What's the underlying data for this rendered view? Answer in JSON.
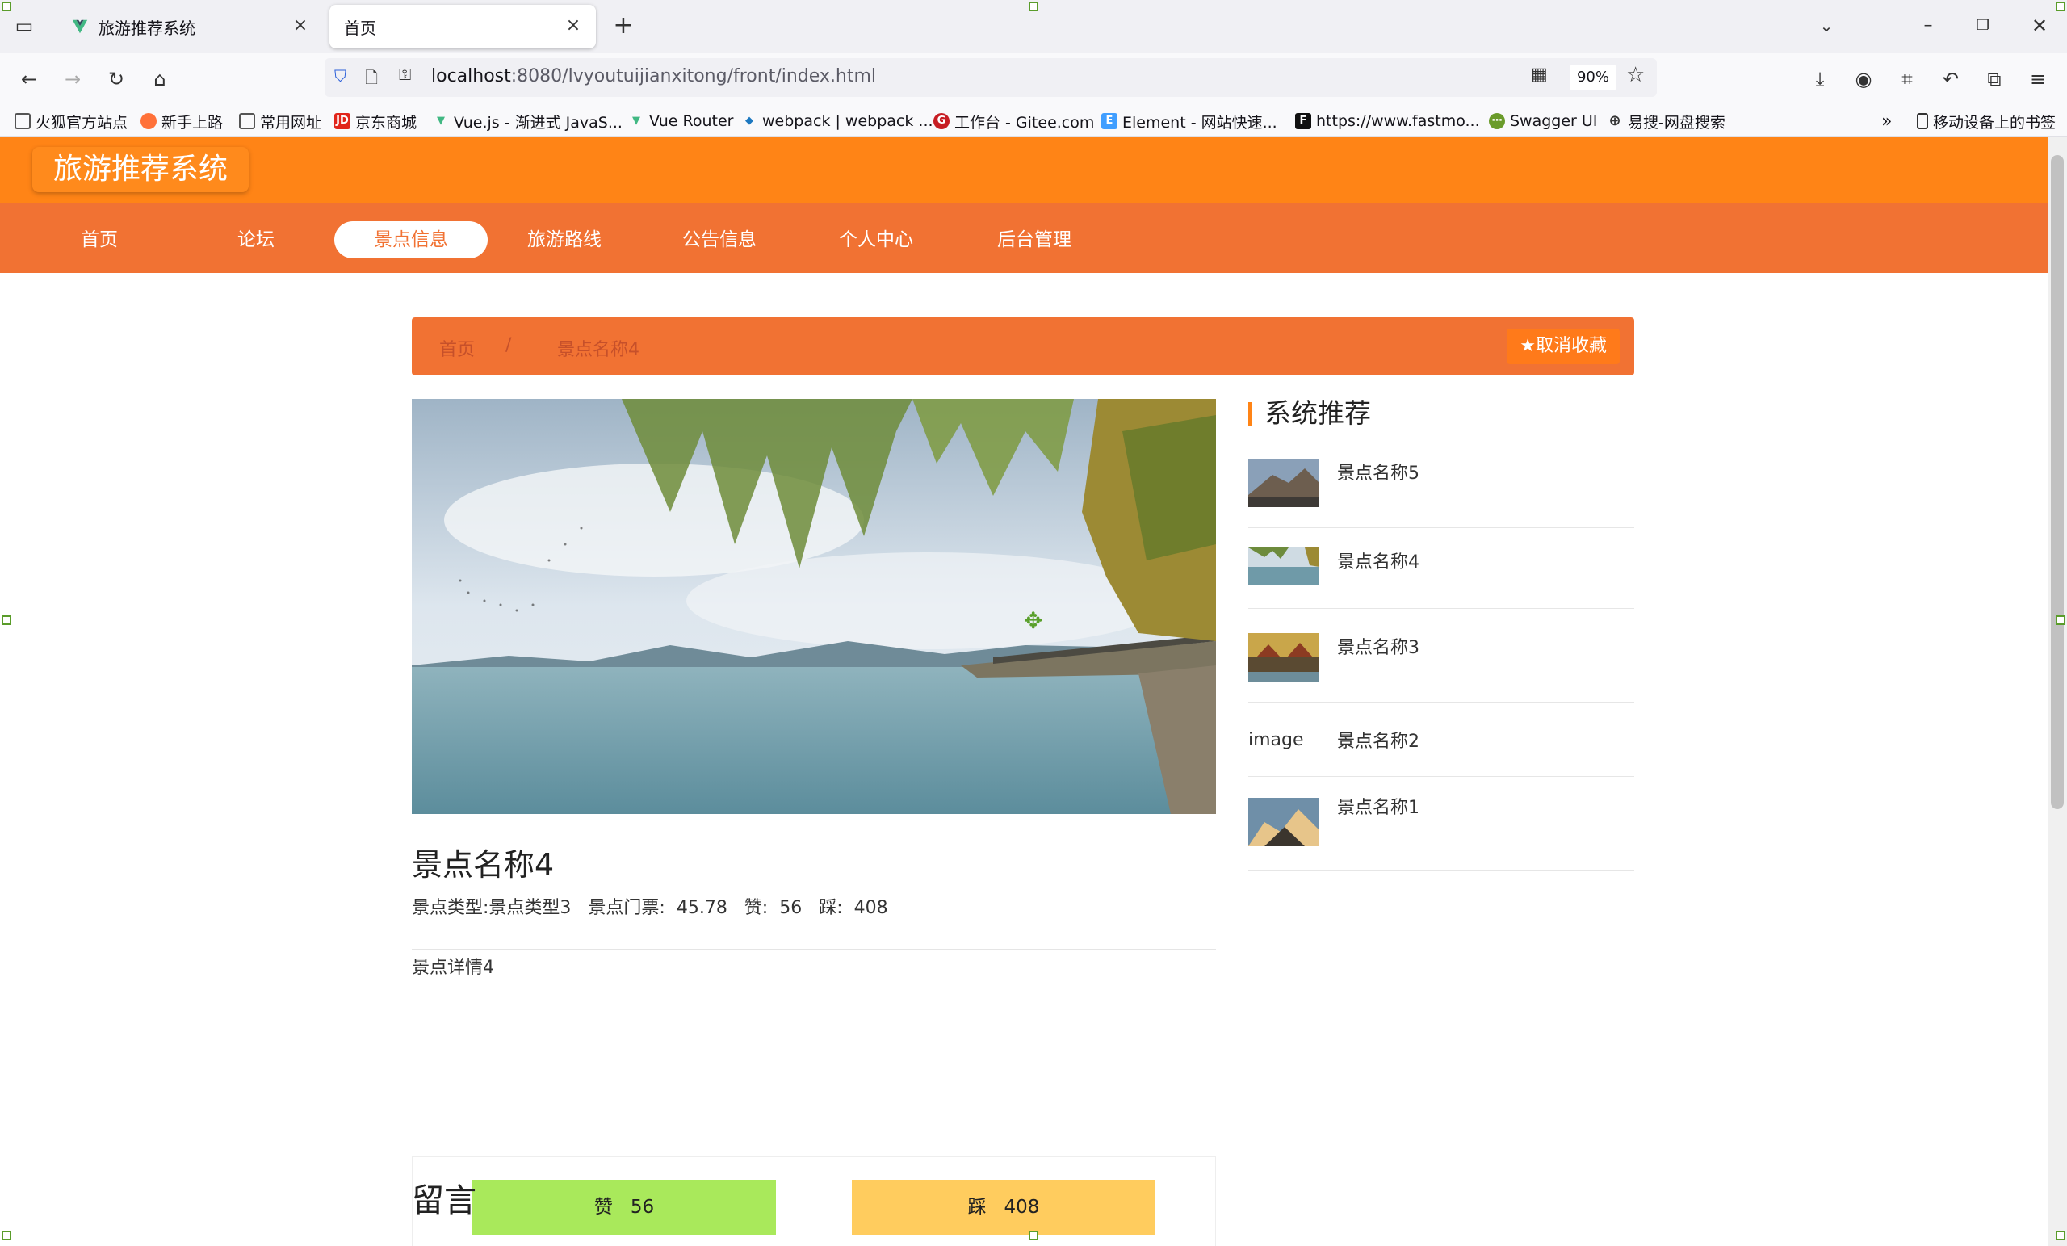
{
  "browser": {
    "tabs": [
      {
        "title": "旅游推荐系统",
        "active": false
      },
      {
        "title": "首页",
        "active": true
      }
    ],
    "url_host": "localhost",
    "url_rest": ":8080/lvyoutuijianxitong/front/index.html",
    "zoom": "90%",
    "bookmarks": [
      "火狐官方站点",
      "新手上路",
      "常用网址",
      "京东商城",
      "Vue.js - 渐进式 JavaS...",
      "Vue Router",
      "webpack | webpack ...",
      "工作台 - Gitee.com",
      "Element - 网站快速...",
      "https://www.fastmo...",
      "Swagger UI",
      "易搜-网盘搜索"
    ],
    "mobile_bookmarks": "移动设备上的书签"
  },
  "site": {
    "title": "旅游推荐系统",
    "nav": [
      {
        "label": "首页",
        "active": false
      },
      {
        "label": "论坛",
        "active": false
      },
      {
        "label": "景点信息",
        "active": true
      },
      {
        "label": "旅游路线",
        "active": false
      },
      {
        "label": "公告信息",
        "active": false
      },
      {
        "label": "个人中心",
        "active": false
      },
      {
        "label": "后台管理",
        "active": false
      }
    ]
  },
  "breadcrumb": {
    "home": "首页",
    "separator": "/",
    "current": "景点名称4"
  },
  "favorite_button": "取消收藏",
  "spot": {
    "name": "景点名称4",
    "type_label": "景点类型:",
    "type_value": "景点类型3",
    "price_label": "景点门票:",
    "price_value": "45.78",
    "like_label": "赞:",
    "like_value": "56",
    "dislike_label": "踩:",
    "dislike_value": "408",
    "detail": "景点详情4"
  },
  "votes": {
    "like": "赞   56",
    "dislike": "踩   408"
  },
  "comments_heading": "留言",
  "recommend": {
    "heading": "系统推荐",
    "items": [
      {
        "name": "景点名称5",
        "image": "mountain"
      },
      {
        "name": "景点名称4",
        "image": "lake"
      },
      {
        "name": "景点名称3",
        "image": "town"
      },
      {
        "name": "景点名称2",
        "image": "broken",
        "alt": "image"
      },
      {
        "name": "景点名称1",
        "image": "peak"
      }
    ]
  },
  "colors": {
    "header": "#ff8416",
    "nav": "#f17233",
    "like": "#a9e95b",
    "dislike": "#ffcc5e"
  }
}
